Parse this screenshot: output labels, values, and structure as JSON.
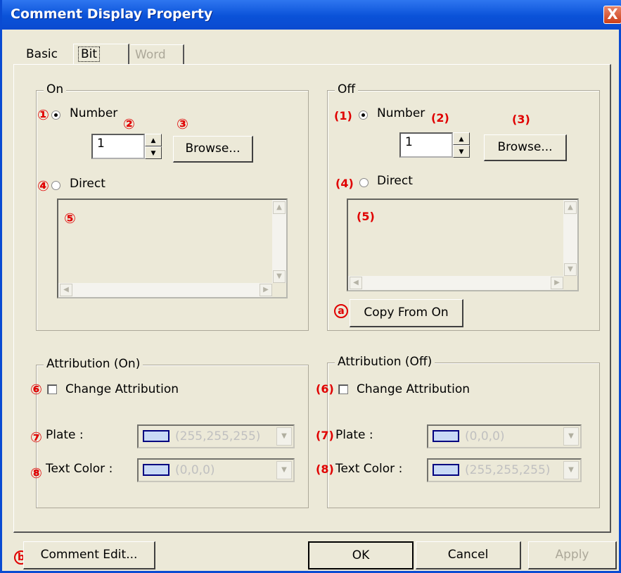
{
  "window": {
    "title": "Comment Display Property",
    "close_glyph": "X"
  },
  "tabs": [
    {
      "label": "Basic"
    },
    {
      "label": "Bit"
    },
    {
      "label": "Word"
    }
  ],
  "on_group": {
    "legend": "On",
    "number_label": "Number",
    "number_value": "1",
    "browse_label": "Browse...",
    "direct_label": "Direct",
    "annotations": {
      "a1": "①",
      "a2": "②",
      "a3": "③",
      "a4": "④",
      "a5": "⑤"
    }
  },
  "off_group": {
    "legend": "Off",
    "number_label": "Number",
    "number_value": "1",
    "browse_label": "Browse...",
    "direct_label": "Direct",
    "copy_label": "Copy From On",
    "annotations": {
      "a1": "(1)",
      "a2": "(2)",
      "a3": "(3)",
      "a4": "(4)",
      "a5": "(5)",
      "aa": "a"
    }
  },
  "attr_on": {
    "legend": "Attribution (On)",
    "change_label": "Change Attribution",
    "plate_label": "Plate :",
    "plate_value": "(255,255,255)",
    "text_color_label": "Text Color :",
    "text_color_value": "(0,0,0)",
    "annotations": {
      "a6": "⑥",
      "a7": "⑦",
      "a8": "⑧"
    }
  },
  "attr_off": {
    "legend": "Attribution (Off)",
    "change_label": "Change Attribution",
    "plate_label": "Plate :",
    "plate_value": "(0,0,0)",
    "text_color_label": "Text Color :",
    "text_color_value": "(255,255,255)",
    "annotations": {
      "a6": "(6)",
      "a7": "(7)",
      "a8": "(8)"
    }
  },
  "footer": {
    "comment_edit_label": "Comment Edit...",
    "ok_label": "OK",
    "cancel_label": "Cancel",
    "apply_label": "Apply",
    "annotation_b": "b"
  },
  "colors": {
    "title_bar": "#0a52d8",
    "annotation": "#e00000",
    "swatch": "#c9daf6"
  },
  "icons": [
    "close-icon",
    "spin-up-icon",
    "spin-down-icon",
    "scroll-up-icon",
    "scroll-down-icon",
    "scroll-left-icon",
    "scroll-right-icon",
    "dropdown-arrow-icon"
  ]
}
